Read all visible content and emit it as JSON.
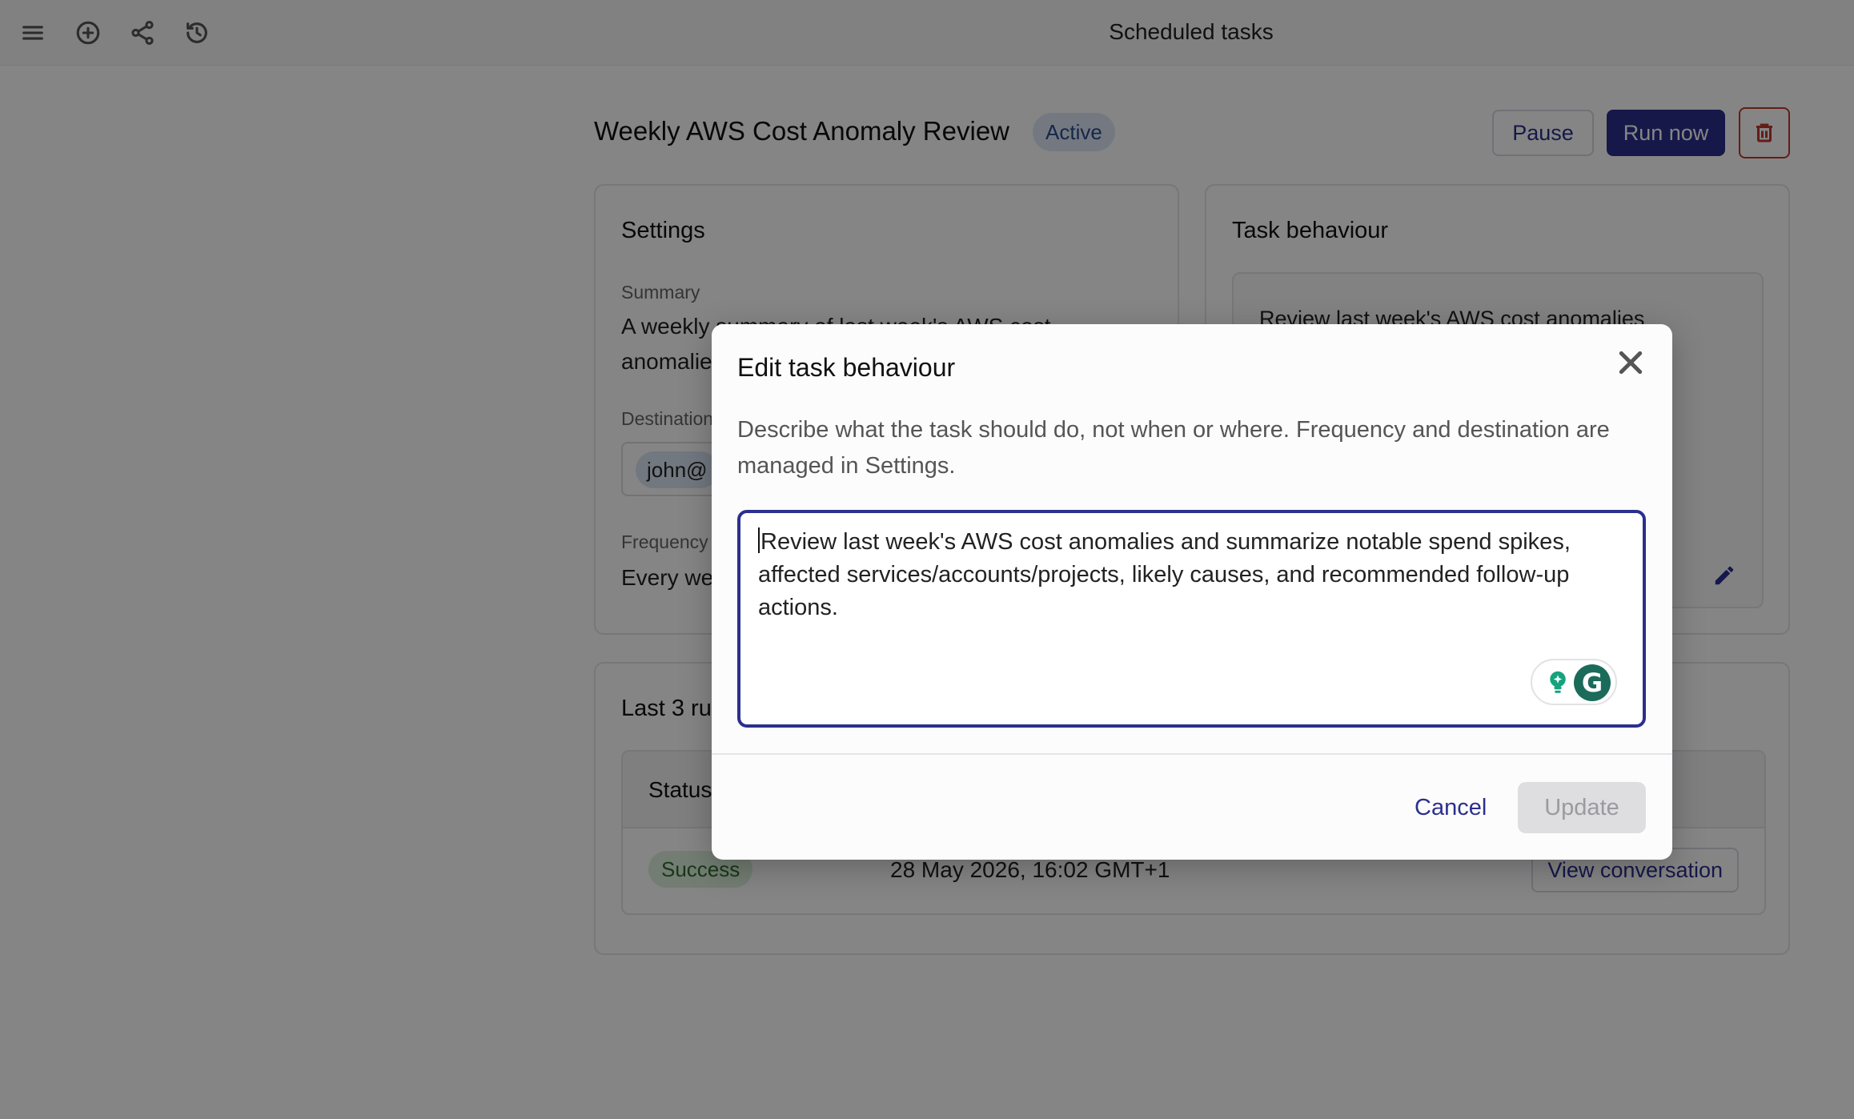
{
  "header": {
    "title": "Scheduled tasks",
    "icons": [
      "menu-icon",
      "add-circle-icon",
      "share-icon",
      "history-icon"
    ]
  },
  "task": {
    "title": "Weekly AWS Cost Anomaly Review",
    "status": "Active",
    "pause_label": "Pause",
    "run_now_label": "Run now",
    "delete_icon": "trash-icon"
  },
  "settings": {
    "title": "Settings",
    "summary_label": "Summary",
    "summary_value": "A weekly summary of last week's AWS cost anomalies",
    "destination_label": "Destination",
    "destination_chip": "john@",
    "frequency_label": "Frequency",
    "frequency_value": "Every we"
  },
  "behaviour": {
    "title": "Task behaviour",
    "text": "Review last week's AWS cost anomalies"
  },
  "runs": {
    "title": "Last 3 ru",
    "status_header": "Status",
    "rows": [
      {
        "status": "Success",
        "date": "28 May 2026, 16:02 GMT+1",
        "action": "View conversation"
      }
    ]
  },
  "modal": {
    "title": "Edit task behaviour",
    "description": "Describe what the task should do, not when or where. Frequency and destination are managed in Settings.",
    "textarea_value": "Review last week's AWS cost anomalies and summarize notable spend spikes, affected services/accounts/projects, likely causes, and recommended follow-up actions.",
    "cancel_label": "Cancel",
    "update_label": "Update"
  },
  "colors": {
    "accent": "#2b2f8e",
    "danger": "#c0392b",
    "success_bg": "#dcefdc",
    "active_badge_bg": "#dfe8f7"
  }
}
